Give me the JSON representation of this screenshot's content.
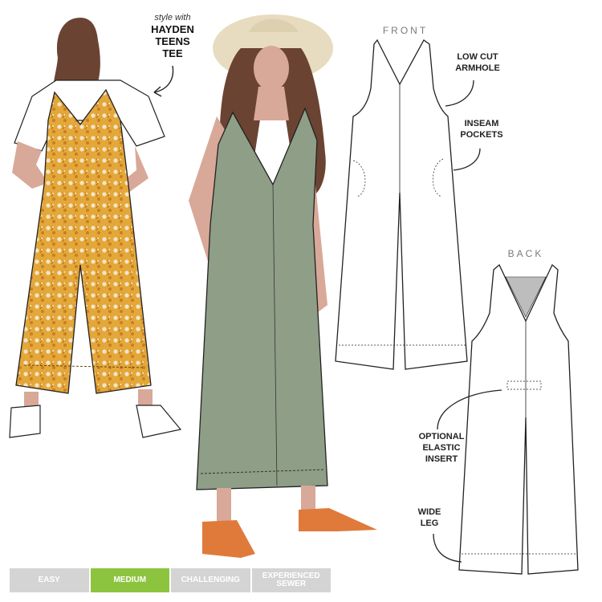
{
  "colors": {
    "mustard": "#e3a73a",
    "sage": "#8f9e87",
    "skin": "#d8a898",
    "hair": "#6b4332",
    "hat": "#e8dcc0",
    "sandal": "#e07a3b",
    "difficulty_active": "#8dc43f",
    "difficulty_inactive": "#d4d4d4"
  },
  "style_with": {
    "note": "style with",
    "line1": "HAYDEN",
    "line2": "TEENS",
    "line3": "TEE"
  },
  "views": {
    "front_label": "FRONT",
    "back_label": "BACK"
  },
  "callouts": {
    "low_cut_1": "LOW CUT",
    "low_cut_2": "ARMHOLE",
    "inseam_1": "INSEAM",
    "inseam_2": "POCKETS",
    "optional_1": "OPTIONAL",
    "optional_2": "ELASTIC",
    "optional_3": "INSERT",
    "wide_1": "WIDE",
    "wide_2": "LEG"
  },
  "difficulty": {
    "levels": [
      "EASY",
      "MEDIUM",
      "CHALLENGING",
      "EXPERIENCED SEWER"
    ],
    "selected": "MEDIUM"
  }
}
